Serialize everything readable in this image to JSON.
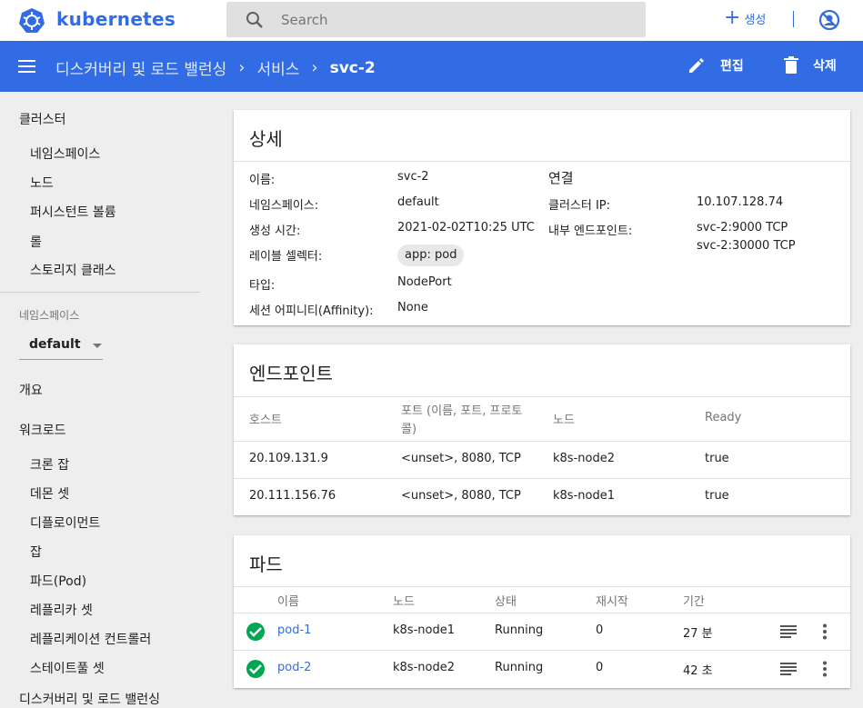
{
  "header": {
    "brand": "kubernetes",
    "search_placeholder": "Search",
    "create_label": "생성"
  },
  "navbar": {
    "crumbs": [
      "디스커버리 및 로드 밸런싱",
      "서비스"
    ],
    "current": "svc-2",
    "edit_label": "편집",
    "delete_label": "삭제"
  },
  "sidebar": {
    "cluster_title": "클러스터",
    "cluster_items": [
      "네임스페이스",
      "노드",
      "퍼시스턴트 볼륨",
      "롤",
      "스토리지 클래스"
    ],
    "namespace_label": "네임스페이스",
    "namespace_value": "default",
    "overview": "개요",
    "workloads_title": "워크로드",
    "workload_items": [
      "크론 잡",
      "데몬 셋",
      "디플로이먼트",
      "잡",
      "파드(Pod)",
      "레플리카 셋",
      "레플리케이션 컨트롤러",
      "스테이트풀 셋"
    ],
    "next_title": "디스커버리 및 로드 밸런싱"
  },
  "details": {
    "title": "상세",
    "name_label": "이름:",
    "name_value": "svc-2",
    "namespace_label": "네임스페이스:",
    "namespace_value": "default",
    "created_label": "생성 시간:",
    "created_value": "2021-02-02T10:25 UTC",
    "selector_label": "레이블 셀렉터:",
    "selector_value": "app: pod",
    "type_label": "타입:",
    "type_value": "NodePort",
    "affinity_label": "세션 어피니티(Affinity):",
    "affinity_value": "None",
    "connection_title": "연결",
    "cluster_ip_label": "클러스터 IP:",
    "cluster_ip_value": "10.107.128.74",
    "internal_ep_label": "내부 엔드포인트:",
    "internal_ep_values": [
      "svc-2:9000 TCP",
      "svc-2:30000 TCP"
    ]
  },
  "endpoints": {
    "title": "엔드포인트",
    "columns": [
      "호스트",
      "포트 (이름, 포트, 프로토",
      "콜)",
      "노드",
      "Ready"
    ],
    "rows": [
      {
        "host": "20.109.131.9",
        "ports": "<unset>, 8080, TCP",
        "node": "k8s-node2",
        "ready": "true"
      },
      {
        "host": "20.111.156.76",
        "ports": "<unset>, 8080, TCP",
        "node": "k8s-node1",
        "ready": "true"
      }
    ]
  },
  "pods": {
    "title": "파드",
    "columns": [
      "이름",
      "노드",
      "상태",
      "재시작",
      "기간"
    ],
    "rows": [
      {
        "name": "pod-1",
        "node": "k8s-node1",
        "status": "Running",
        "restarts": "0",
        "age": "27 분"
      },
      {
        "name": "pod-2",
        "node": "k8s-node2",
        "status": "Running",
        "restarts": "0",
        "age": "42 초"
      }
    ]
  },
  "colors": {
    "primary": "#326ce5",
    "success": "#00a651",
    "background": "#eeeeee"
  },
  "icons": [
    "kubernetes-logo-icon",
    "search-icon",
    "plus-icon",
    "user-off-icon",
    "menu-icon",
    "chevron-right-icon",
    "pencil-icon",
    "trash-icon",
    "caret-down-icon",
    "check-circle-icon",
    "logs-icon",
    "more-vert-icon"
  ]
}
